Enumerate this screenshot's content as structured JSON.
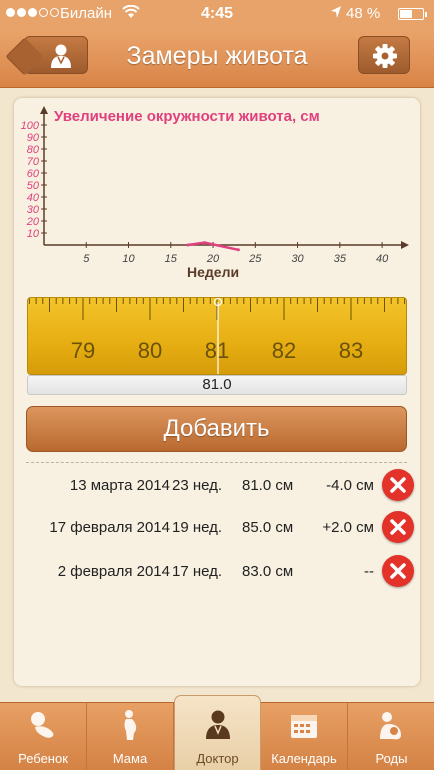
{
  "status_bar": {
    "carrier": "Билайн",
    "time": "4:45",
    "battery": "48 %",
    "battery_level": 0.48
  },
  "nav": {
    "title": "Замеры живота",
    "back_icon": "doctor-icon",
    "settings_icon": "gear-icon"
  },
  "chart_data": {
    "type": "line",
    "title": "Увеличение окружности живота, см",
    "xlabel": "Недели",
    "ylabel": "",
    "xlim": [
      0,
      42
    ],
    "ylim": [
      0,
      100
    ],
    "x_ticks": [
      "5",
      "10",
      "15",
      "20",
      "25",
      "30",
      "35",
      "40"
    ],
    "y_ticks": [
      "10",
      "20",
      "30",
      "40",
      "50",
      "60",
      "70",
      "80",
      "90",
      "100"
    ],
    "series": [
      {
        "x": [
          17,
          19,
          23
        ],
        "y": [
          0,
          2,
          -4
        ]
      }
    ],
    "grid": false,
    "line_color": "#e0407e"
  },
  "ruler": {
    "labels": [
      "79",
      "80",
      "81",
      "82",
      "83"
    ],
    "value": "81.0"
  },
  "add_button": "Добавить",
  "entries": [
    {
      "date": "13 марта 2014",
      "week": "23 нед.",
      "size": "81.0 см",
      "diff": "-4.0 см"
    },
    {
      "date": "17 февраля 2014",
      "week": "19 нед.",
      "size": "85.0 см",
      "diff": "+2.0 см"
    },
    {
      "date": "2 февраля 2014",
      "week": "17 нед.",
      "size": "83.0 см",
      "diff": "--"
    }
  ],
  "tabs": [
    {
      "label": "Ребенок",
      "icon": "baby-icon"
    },
    {
      "label": "Мама",
      "icon": "mother-icon"
    },
    {
      "label": "Доктор",
      "icon": "doctor-icon"
    },
    {
      "label": "Календарь",
      "icon": "calendar-icon"
    },
    {
      "label": "Роды",
      "icon": "birth-icon"
    }
  ],
  "active_tab": "Доктор",
  "colors": {
    "accent": "#d98447",
    "chart_pink": "#e0407e",
    "delete_red": "#e2322a",
    "ruler_yellow": "#f0bd22"
  }
}
